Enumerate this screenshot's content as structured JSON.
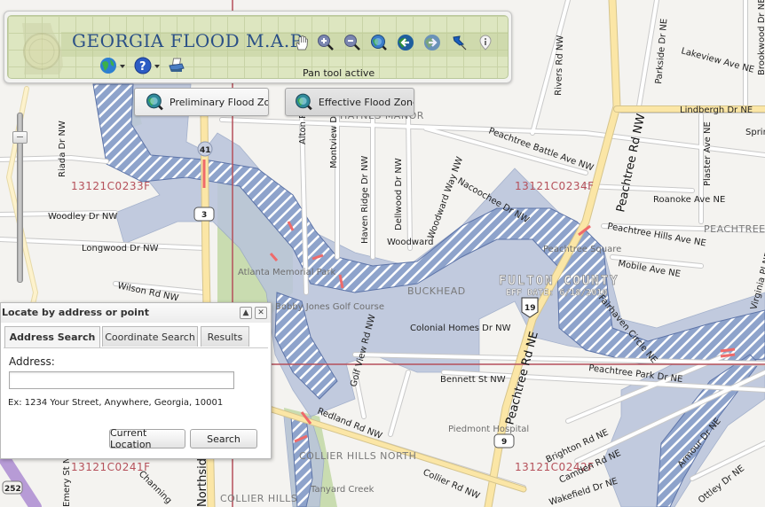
{
  "app": {
    "title": "GEORGIA FLOOD M.A.P.",
    "status": "Pan tool active"
  },
  "toolbar": {
    "tools": [
      {
        "name": "pan",
        "icon": "hand-icon",
        "active": true
      },
      {
        "name": "zoom-in",
        "icon": "zoom-in-icon"
      },
      {
        "name": "zoom-out",
        "icon": "zoom-out-icon"
      },
      {
        "name": "full-extent",
        "icon": "globe-magnifier-icon"
      },
      {
        "name": "previous-extent",
        "icon": "back-arrow-icon"
      },
      {
        "name": "next-extent",
        "icon": "forward-arrow-icon"
      },
      {
        "name": "pushpin",
        "icon": "pushpin-icon"
      },
      {
        "name": "identify",
        "icon": "info-icon"
      }
    ],
    "secondary": [
      {
        "name": "basemap",
        "icon": "globe-icon",
        "dropdown": true
      },
      {
        "name": "help",
        "icon": "help-icon",
        "dropdown": true
      },
      {
        "name": "print",
        "icon": "printer-icon"
      }
    ]
  },
  "flood_buttons": {
    "preliminary": "Preliminary Flood Zoı",
    "effective": "Effective Flood Zone"
  },
  "zoom_slider": {
    "level_fraction": 0.12
  },
  "locate_panel": {
    "title": "Locate by address or point",
    "minimize": "▲",
    "close": "✕",
    "tabs": [
      {
        "label": "Address Search",
        "active": true
      },
      {
        "label": "Coordinate Search",
        "active": false
      },
      {
        "label": "Results",
        "active": false
      }
    ],
    "address_label": "Address:",
    "address_value": "",
    "address_placeholder": "",
    "hint": "Ex: 1234 Your Street, Anywhere, Georgia, 10001",
    "current_location_button": "Current Location",
    "search_button": "Search"
  },
  "map": {
    "colors": {
      "background": "#f4f3f0",
      "road": "#ffffff",
      "road_casing": "#c9c9c9",
      "highway": "#fbe6a6",
      "flood_zone": "#b9c4dc",
      "floodway": "#7f97c2",
      "park": "#c9dcb0",
      "panel_line": "#b5505a",
      "panel_label": "#b5505a"
    },
    "panel_ids": [
      "13121C0233F",
      "13121C0234F",
      "13121C0241F",
      "13121C0242F"
    ],
    "county": {
      "name": "FULTON COUNTY",
      "eff_date": "EFF DATE: 6/18/2010"
    },
    "neighborhoods": [
      "HAYNES MANOR",
      "BUCKHEAD",
      "PEACHTREE H",
      "COLLIER HILLS NORTH",
      "COLLIER HILLS"
    ],
    "pois": [
      "Peachtree Square",
      "Piedmont Hospital",
      "Atlanta Memorial Park",
      "Bobby Jones Golf Course",
      "Tanyard Creek"
    ],
    "shields": [
      "41",
      "3",
      "19",
      "9",
      "252"
    ],
    "roads": [
      "Peachtree Rd NW",
      "Peachtree Rd NE",
      "Lindbergh Dr NE",
      "Rivers Rd NW",
      "Parkside Dr NE",
      "Lakeview Ave NE",
      "Brookwood Dr NE",
      "Peachtree Battle Ave NW",
      "Roanoke Ave NE",
      "Plaster Ave NE",
      "Peachtree Hills Ave NE",
      "Mobile Ave NE",
      "Fairhaven Circle NE",
      "Virginia Pl NE",
      "Spring",
      "Nacoochee Dr NW",
      "Woodward Way NW",
      "Dellwood Dr NW",
      "Haven Ridge Dr NW",
      "Montview Dr",
      "Alton Rd",
      "Riada Dr NW",
      "Woodley Dr NW",
      "Longwood Dr NW",
      "Wilson Rd NW",
      "Colonial Homes Dr NW",
      "Bennett St NW",
      "Redland Rd NW",
      "Collier Rd NW",
      "Golf View Rd NW",
      "Peachtree Park Dr NE",
      "Brighton Rd NE",
      "Camden Rd NE",
      "Wakefield Dr NE",
      "Armour Dr NE",
      "Ottley Dr NE",
      "Emery St NW",
      "Channing",
      "Northside Dr NW",
      "Woodward",
      "Ridge Dr NW"
    ]
  }
}
